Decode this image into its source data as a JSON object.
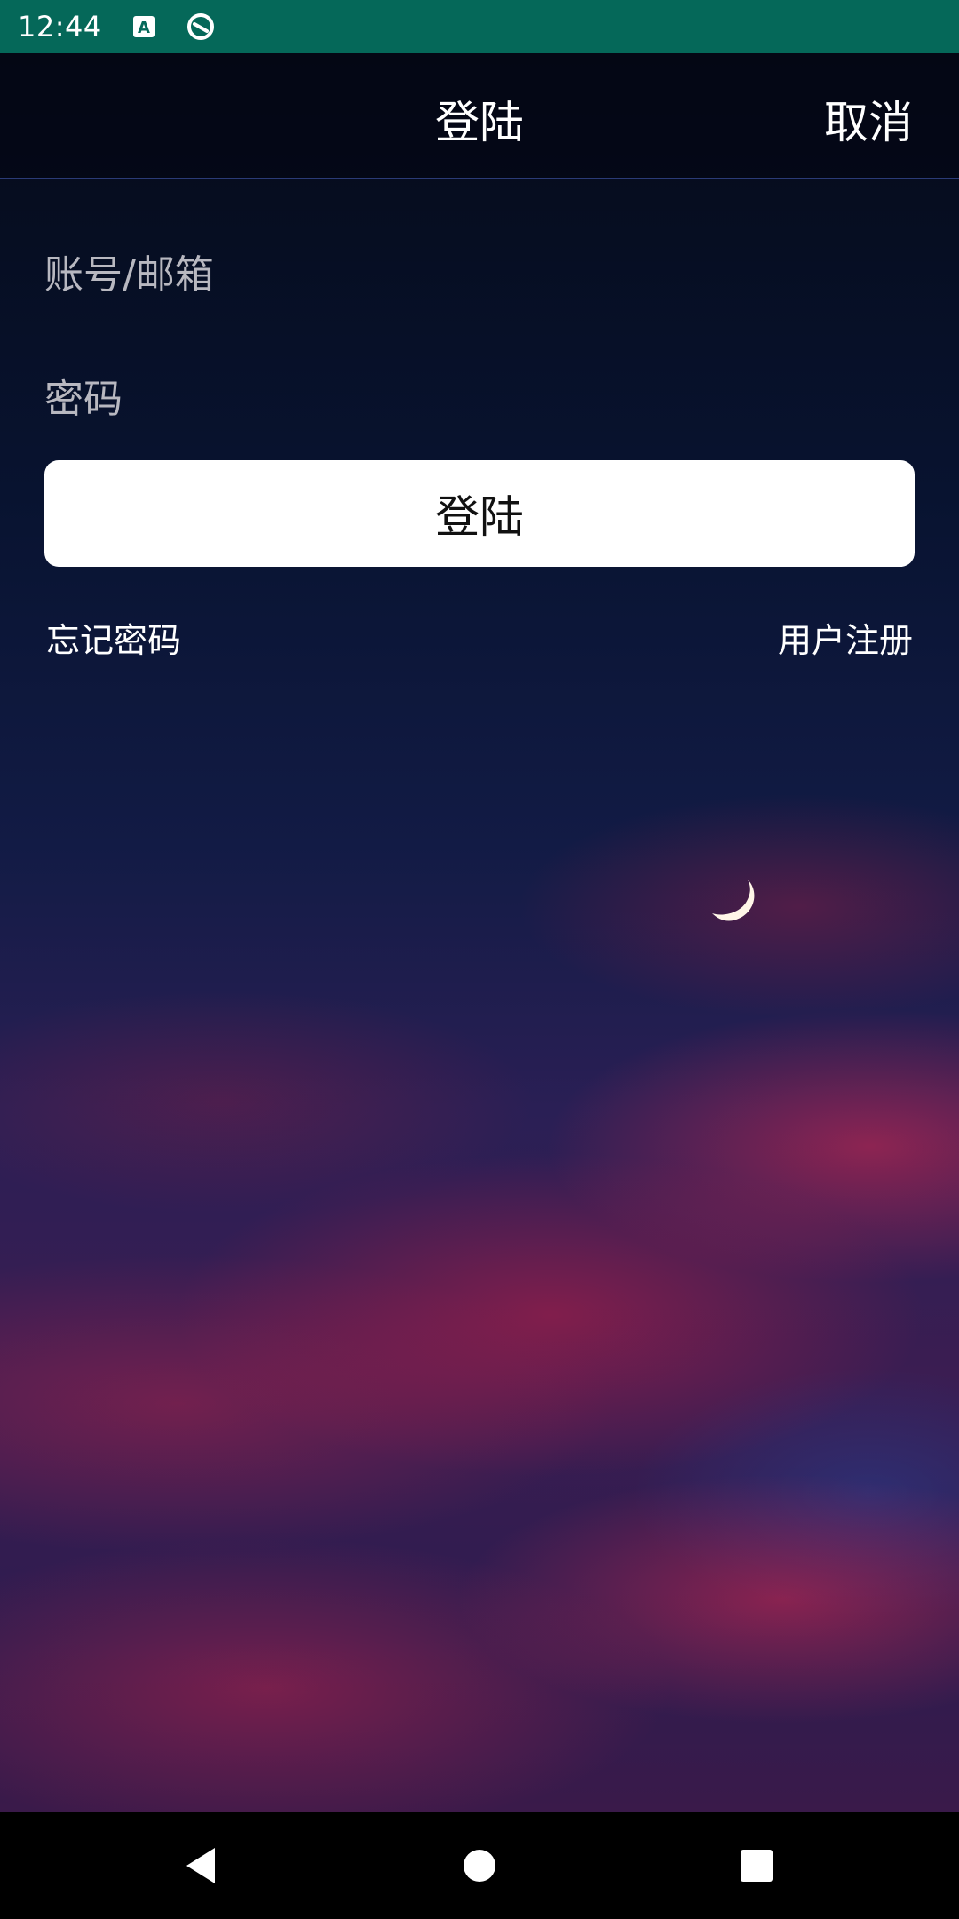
{
  "status_bar": {
    "time": "12:44",
    "icons": [
      "a-notification-icon",
      "sync-icon"
    ],
    "background_color": "#056859"
  },
  "header": {
    "title": "登陆",
    "cancel_label": "取消"
  },
  "form": {
    "account_placeholder": "账号/邮箱",
    "password_placeholder": "密码",
    "login_button_label": "登陆"
  },
  "links": {
    "forgot_password": "忘记密码",
    "register": "用户注册"
  },
  "nav_bar": {
    "icons": [
      "back-icon",
      "home-icon",
      "recents-icon"
    ]
  }
}
